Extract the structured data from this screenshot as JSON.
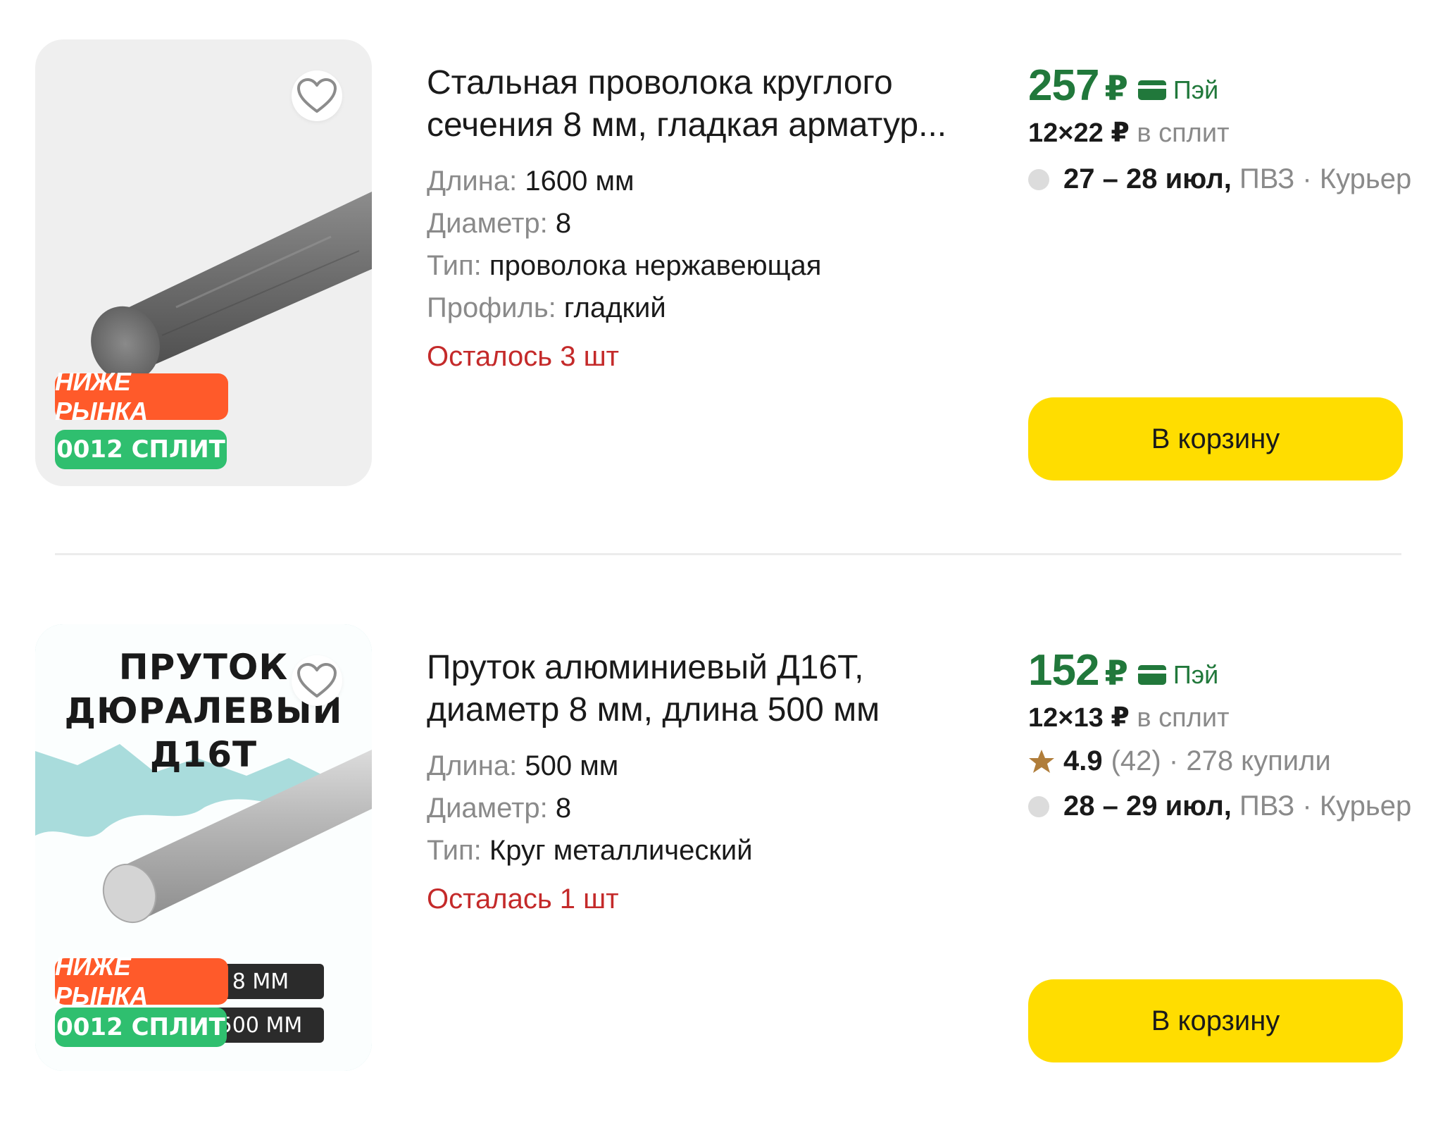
{
  "products": [
    {
      "title": "Стальная проволока круглого сечения 8 мм, гладкая арматур...",
      "specs": [
        {
          "key": "Длина:",
          "value": "1600 мм"
        },
        {
          "key": "Диаметр:",
          "value": "8"
        },
        {
          "key": "Тип:",
          "value": "проволока нержавеющая"
        },
        {
          "key": "Профиль:",
          "value": "гладкий"
        }
      ],
      "stock": "Осталось 3 шт",
      "price": "257",
      "currency": "₽",
      "pay_label": "Пэй",
      "split": {
        "months": "12",
        "times": "×",
        "amount": "22",
        "currency": "₽",
        "label": "в сплит"
      },
      "delivery": {
        "dates": "27 – 28 июл",
        "comma": ",",
        "pickup": "ПВЗ",
        "sep": "·",
        "courier": "Курьер"
      },
      "badges": {
        "market": "НИЖЕ РЫНКА",
        "split": "0012 СПЛИТ"
      },
      "cart_label": "В корзину"
    },
    {
      "title": "Пруток алюминиевый Д16Т, диаметр 8 мм, длина 500 мм",
      "image_title": "ПРУТОК ДЮРАЛЕВЫЙ Д16Т",
      "specs": [
        {
          "key": "Длина:",
          "value": "500 мм"
        },
        {
          "key": "Диаметр:",
          "value": "8"
        },
        {
          "key": "Тип:",
          "value": "Круг металлический"
        }
      ],
      "stock": "Осталась 1 шт",
      "price": "152",
      "currency": "₽",
      "pay_label": "Пэй",
      "split": {
        "months": "12",
        "times": "×",
        "amount": "13",
        "currency": "₽",
        "label": "в сплит"
      },
      "rating": {
        "value": "4.9",
        "count": "(42)",
        "sep": "·",
        "bought": "278 купили"
      },
      "delivery": {
        "dates": "28 – 29 июл",
        "comma": ",",
        "pickup": "ПВЗ",
        "sep": "·",
        "courier": "Курьер"
      },
      "badges": {
        "market": "НИЖЕ РЫНКА",
        "split": "0012 СПЛИТ",
        "chip_diameter": "8 ММ",
        "chip_length": "500 ММ"
      },
      "cart_label": "В корзину"
    }
  ],
  "colors": {
    "price": "#21783b",
    "stock": "#c42a2a",
    "cart": "#ffdd00",
    "market_badge": "#ff5a2a",
    "split_badge": "#2fbf6f",
    "star": "#b07d3a"
  },
  "icons": {
    "favorite": "heart-icon",
    "pay": "card-icon",
    "rating": "star-icon",
    "delivery": "dot-icon"
  }
}
